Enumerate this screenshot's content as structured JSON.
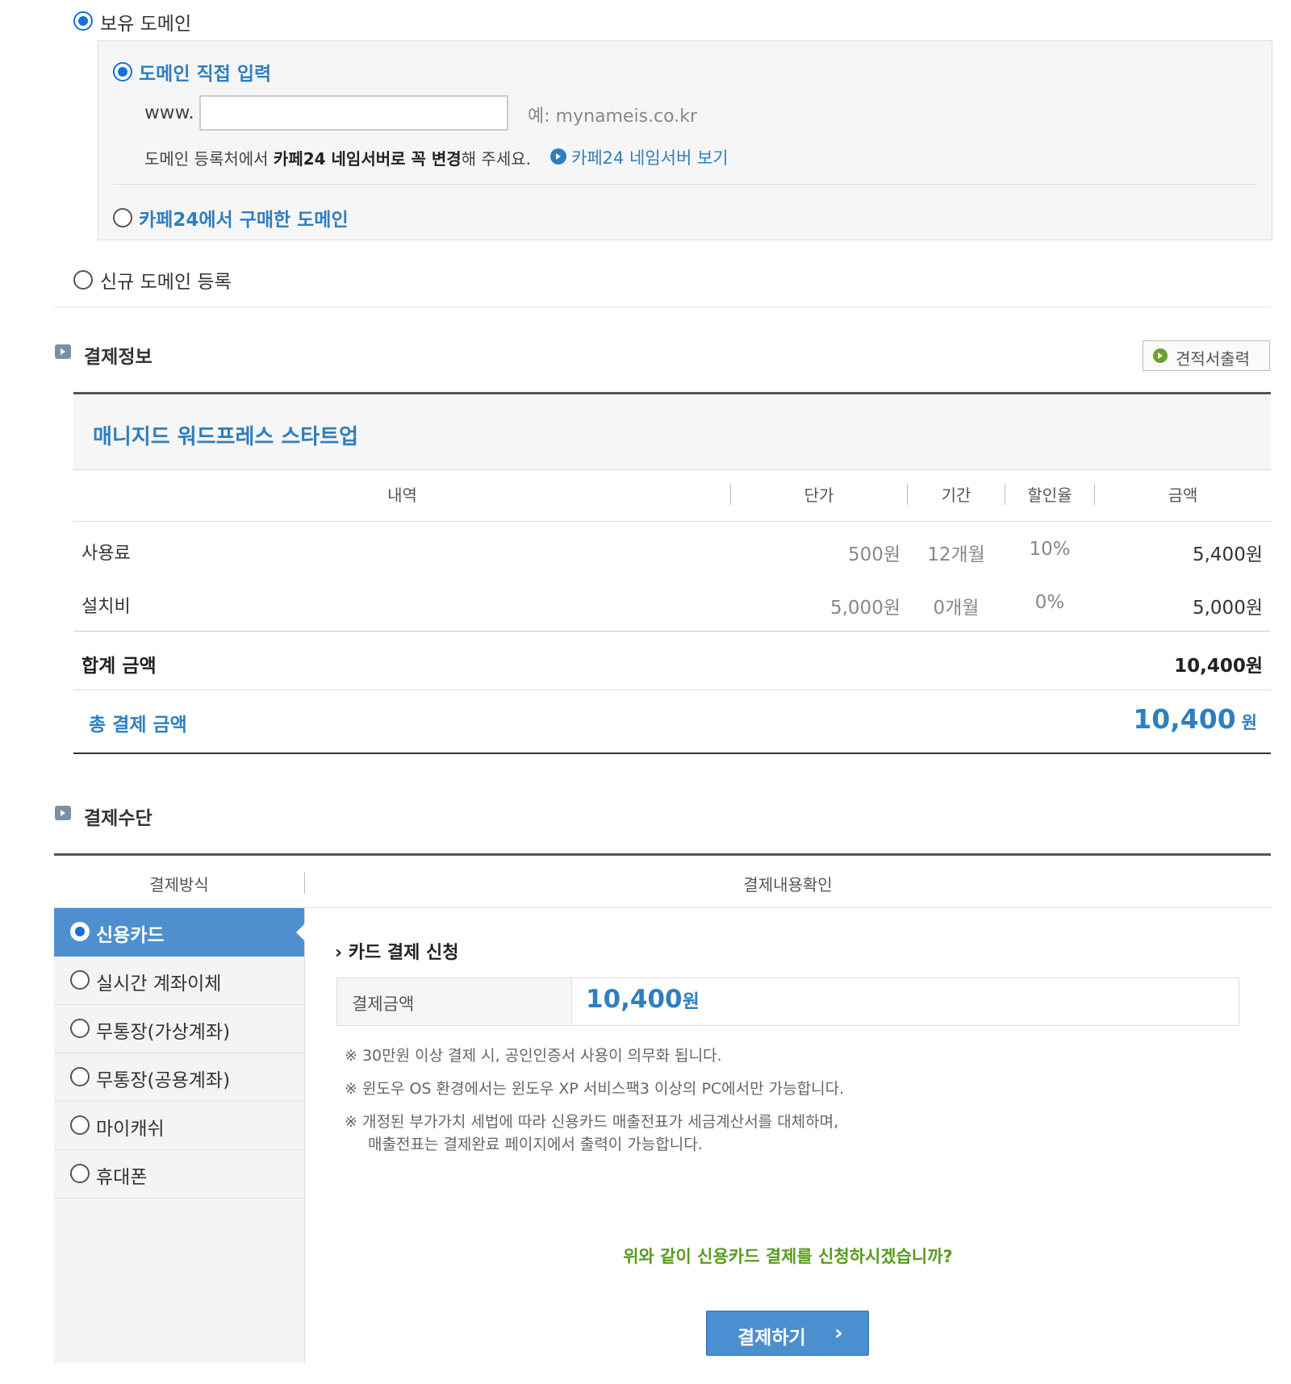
{
  "domain_section": {
    "owned_label": "보유 도메인",
    "direct_input_label": "도메인 직접 입력",
    "www_prefix": "www.",
    "domain_value": "",
    "example_text": "예: mynameis.co.kr",
    "notice_pre": "도메인 등록처에서 ",
    "notice_bold": "카페24 네임서버로 꼭 변경",
    "notice_post": "해 주세요.",
    "nameserver_link": "카페24 네임서버 보기",
    "purchased_label": "카페24에서 구매한 도메인",
    "new_domain_label": "신규 도메인 등록"
  },
  "payment_info": {
    "section_title": "결제정보",
    "quote_button": "견적서출력",
    "product_name": "매니지드 워드프레스 스타트업",
    "columns": [
      "내역",
      "단가",
      "기간",
      "할인율",
      "금액"
    ],
    "rows": [
      {
        "item": "사용료",
        "unit_price": "500원",
        "period": "12개월",
        "discount": "10%",
        "amount": "5,400원"
      },
      {
        "item": "설치비",
        "unit_price": "5,000원",
        "period": "0개월",
        "discount": "0%",
        "amount": "5,000원"
      }
    ],
    "subtotal_label": "합계 금액",
    "subtotal_value": "10,400원",
    "total_label": "총 결제 금액",
    "total_value": "10,400",
    "total_unit": "원"
  },
  "payment_method": {
    "section_title": "결제수단",
    "col_method": "결제방식",
    "col_confirm": "결제내용확인",
    "methods": [
      "신용카드",
      "실시간 계좌이체",
      "무통장(가상계좌)",
      "무통장(공용계좌)",
      "마이캐쉬",
      "휴대폰"
    ],
    "selected_index": 0,
    "card_title": "카드 결제 신청",
    "amount_label": "결제금액",
    "amount_value": "10,400",
    "amount_unit": "원",
    "notes": [
      "※ 30만원 이상 결제 시, 공인인증서 사용이 의무화 됩니다.",
      "※ 윈도우 OS 환경에서는 윈도우 XP 서비스팩3 이상의 PC에서만 가능합니다.",
      "※ 개정된 부가가치 세법에 따라 신용카드 매출전표가 세금계산서를 대체하며,",
      "매출전표는 결제완료 페이지에서 출력이 가능합니다."
    ],
    "confirm_question": "위와 같이 신용카드 결제를 신청하시겠습니까?",
    "pay_button": "결제하기"
  },
  "colors": {
    "accent_blue": "#2f7fbf",
    "button_blue": "#4a8fd0",
    "green_text": "#5a9a1f",
    "selected_method": "#4f8fcf"
  }
}
